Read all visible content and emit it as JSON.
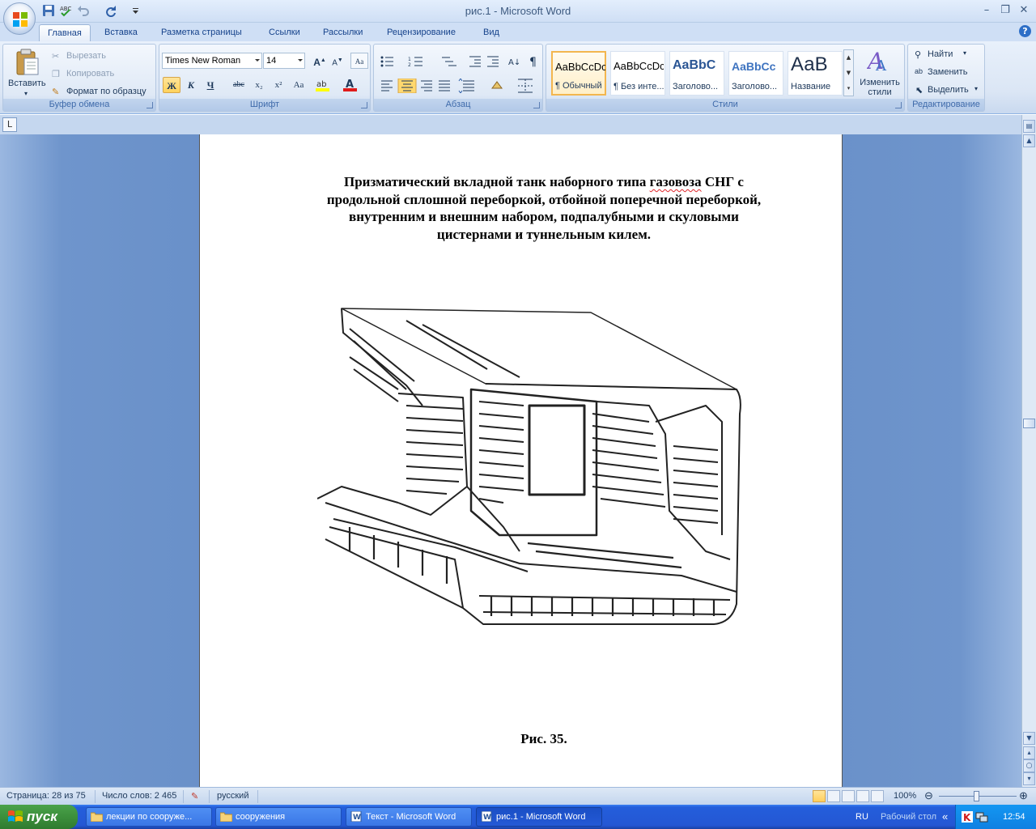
{
  "window": {
    "title": "рис.1 - Microsoft Word"
  },
  "tabs": [
    "Главная",
    "Вставка",
    "Разметка страницы",
    "Ссылки",
    "Рассылки",
    "Рецензирование",
    "Вид"
  ],
  "clipboard": {
    "paste": "Вставить",
    "cut": "Вырезать",
    "copy": "Копировать",
    "format_painter": "Формат по образцу",
    "label": "Буфер обмена"
  },
  "font": {
    "name": "Times New Roman",
    "size": "14",
    "label": "Шрифт",
    "bold": "Ж",
    "italic": "К",
    "underline": "Ч",
    "strike": "abc",
    "subscript": "x₂",
    "superscript": "x²",
    "case": "Aa"
  },
  "paragraph": {
    "label": "Абзац"
  },
  "styles": {
    "label": "Стили",
    "items": [
      {
        "sample": "AaBbCcDc",
        "name": "¶ Обычный"
      },
      {
        "sample": "AaBbCcDc",
        "name": "¶ Без инте..."
      },
      {
        "sample": "AaBbC",
        "name": "Заголово..."
      },
      {
        "sample": "AaBbCc",
        "name": "Заголово..."
      },
      {
        "sample": "АаВ",
        "name": "Название"
      }
    ],
    "change": "Изменить стили"
  },
  "editing": {
    "find": "Найти",
    "replace": "Заменить",
    "select": "Выделить",
    "label": "Редактирование"
  },
  "document": {
    "title_lines": [
      "Призматический вкладной танк наборного типа газовоза СНГ с",
      "продольной сплошной переборкой, отбойной поперечной переборкой,",
      "внутренним и внешним набором, подпалубными и скуловыми",
      "цистернами и туннельным килем."
    ],
    "caption": "Рис. 35."
  },
  "status": {
    "page": "Страница: 28 из 75",
    "words": "Число слов: 2 465",
    "language": "русский",
    "zoom": "100%"
  },
  "taskbar": {
    "start": "пуск",
    "tasks": [
      "лекции по сооруже...",
      "сооружения",
      "Текст - Microsoft Word",
      "рис.1 - Microsoft Word"
    ],
    "lang": "RU",
    "desktop": "Рабочий стол",
    "clock": "12:54"
  }
}
